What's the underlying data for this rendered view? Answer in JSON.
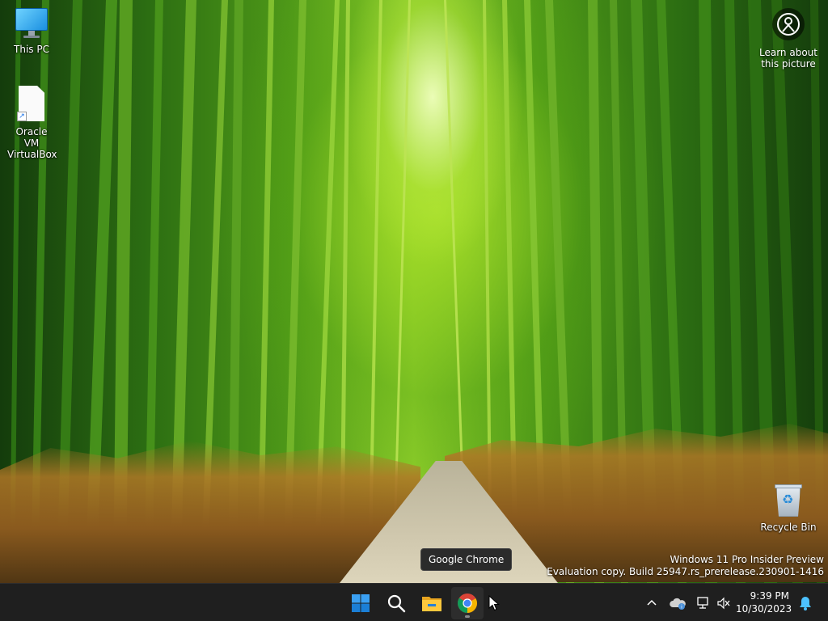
{
  "desktop": {
    "icons": [
      {
        "label": "This PC",
        "icon": "monitor-icon"
      },
      {
        "label": "Oracle VM VirtualBox",
        "icon": "shortcut-file-icon"
      },
      {
        "label": "Recycle Bin",
        "icon": "recycle-bin-icon"
      }
    ],
    "spotlight": {
      "label": "Learn about this picture",
      "icon": "camera-icon"
    },
    "watermark": {
      "line1": "Windows 11 Pro Insider Preview",
      "line2": "Evaluation copy. Build 25947.rs_prerelease.230901-1416"
    }
  },
  "tooltip": {
    "text": "Google Chrome"
  },
  "taskbar": {
    "apps": [
      {
        "name": "Start",
        "icon": "windows-logo-icon"
      },
      {
        "name": "Search",
        "icon": "search-icon"
      },
      {
        "name": "File Explorer",
        "icon": "folder-icon"
      },
      {
        "name": "Google Chrome",
        "icon": "chrome-icon"
      }
    ],
    "tray": {
      "icons": [
        "chevron-up-icon",
        "onedrive-icon",
        "network-icon",
        "volume-muted-icon",
        "notification-bell-icon"
      ]
    },
    "clock": {
      "time": "9:39 PM",
      "date": "10/30/2023"
    }
  },
  "colors": {
    "taskbar_bg": "#1f1f1f",
    "windows_blue": "#0078d4",
    "chrome_red": "#db4437",
    "chrome_yellow": "#f4b400",
    "chrome_green": "#0f9d58",
    "chrome_blue": "#4285f4",
    "folder_yellow": "#ffc83d",
    "bell_blue": "#4cc2ff"
  }
}
